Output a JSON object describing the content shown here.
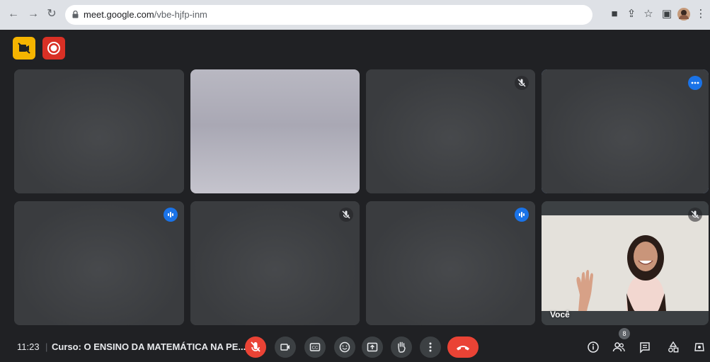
{
  "browser": {
    "url_host": "meet.google.com",
    "url_path": "/vbe-hjfp-inm"
  },
  "tiles": [
    {
      "indicator": "none"
    },
    {
      "indicator": "none"
    },
    {
      "indicator": "muted"
    },
    {
      "indicator": "more-options"
    },
    {
      "indicator": "speaking"
    },
    {
      "indicator": "muted"
    },
    {
      "indicator": "speaking"
    },
    {
      "indicator": "muted",
      "name": "Você"
    }
  ],
  "bottombar": {
    "time": "11:23",
    "separator": "|",
    "meeting_title": "Curso: O ENSINO DA MATEMÁTICA NA PE...",
    "participants_count": "8"
  },
  "colors": {
    "accent_blue": "#1a73e8",
    "active_outline": "#8ab4f8",
    "red": "#ea4335",
    "yellow": "#f5b400",
    "tile_bg": "#3c4043",
    "page_bg": "#202124"
  }
}
